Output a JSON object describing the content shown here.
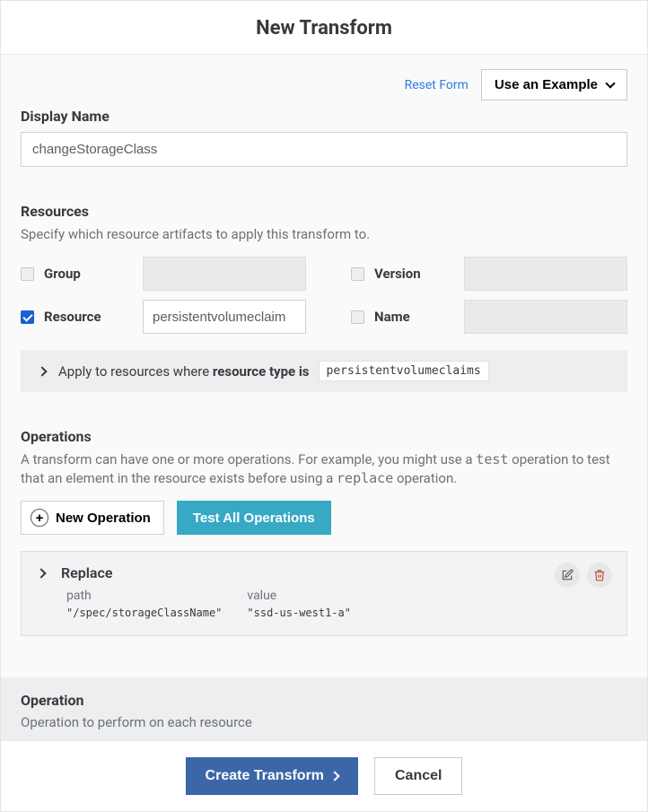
{
  "page_title": "New Transform",
  "top_actions": {
    "reset": "Reset Form",
    "example": "Use an Example"
  },
  "display_name": {
    "label": "Display Name",
    "value": "changeStorageClass"
  },
  "resources": {
    "heading": "Resources",
    "desc": "Specify which resource artifacts to apply this transform to.",
    "fields": {
      "group": {
        "label": "Group",
        "checked": false,
        "value": ""
      },
      "version": {
        "label": "Version",
        "checked": false,
        "value": ""
      },
      "resource": {
        "label": "Resource",
        "checked": true,
        "value": "persistentvolumeclaim"
      },
      "name": {
        "label": "Name",
        "checked": false,
        "value": ""
      }
    },
    "apply_bar": {
      "prefix": "Apply to resources where ",
      "bold": "resource type is",
      "value": "persistentvolumeclaims"
    }
  },
  "operations": {
    "heading": "Operations",
    "desc_pre": "A transform can have one or more operations. For example, you might use a ",
    "desc_code1": "test",
    "desc_mid": " operation to test that an element in the resource exists before using a ",
    "desc_code2": "replace",
    "desc_post": " operation.",
    "buttons": {
      "new": "New Operation",
      "test_all": "Test All Operations"
    },
    "list": [
      {
        "title": "Replace",
        "cols": [
          {
            "label": "path",
            "value": "\"/spec/storageClassName\""
          },
          {
            "label": "value",
            "value": "\"ssd-us-west1-a\""
          }
        ]
      }
    ]
  },
  "operation_section": {
    "heading": "Operation",
    "desc": "Operation to perform on each resource"
  },
  "footer": {
    "create": "Create Transform",
    "cancel": "Cancel"
  }
}
